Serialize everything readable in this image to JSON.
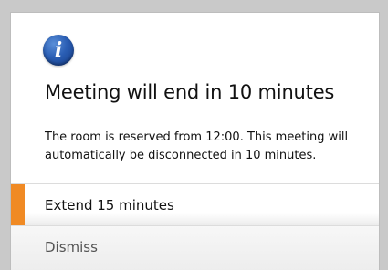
{
  "dialog": {
    "icon": "info-icon",
    "icon_glyph": "i",
    "title": "Meeting will end in 10 minutes",
    "message": "The room is reserved from 12:00. This meeting will automatically be disconnected in 10 minutes.",
    "options": [
      {
        "label": "Extend 15 minutes",
        "selected": true
      },
      {
        "label": "Dismiss",
        "selected": false
      }
    ]
  },
  "colors": {
    "accent": "#f08a24",
    "icon_blue": "#2a5eb4",
    "background": "#ffffff"
  }
}
